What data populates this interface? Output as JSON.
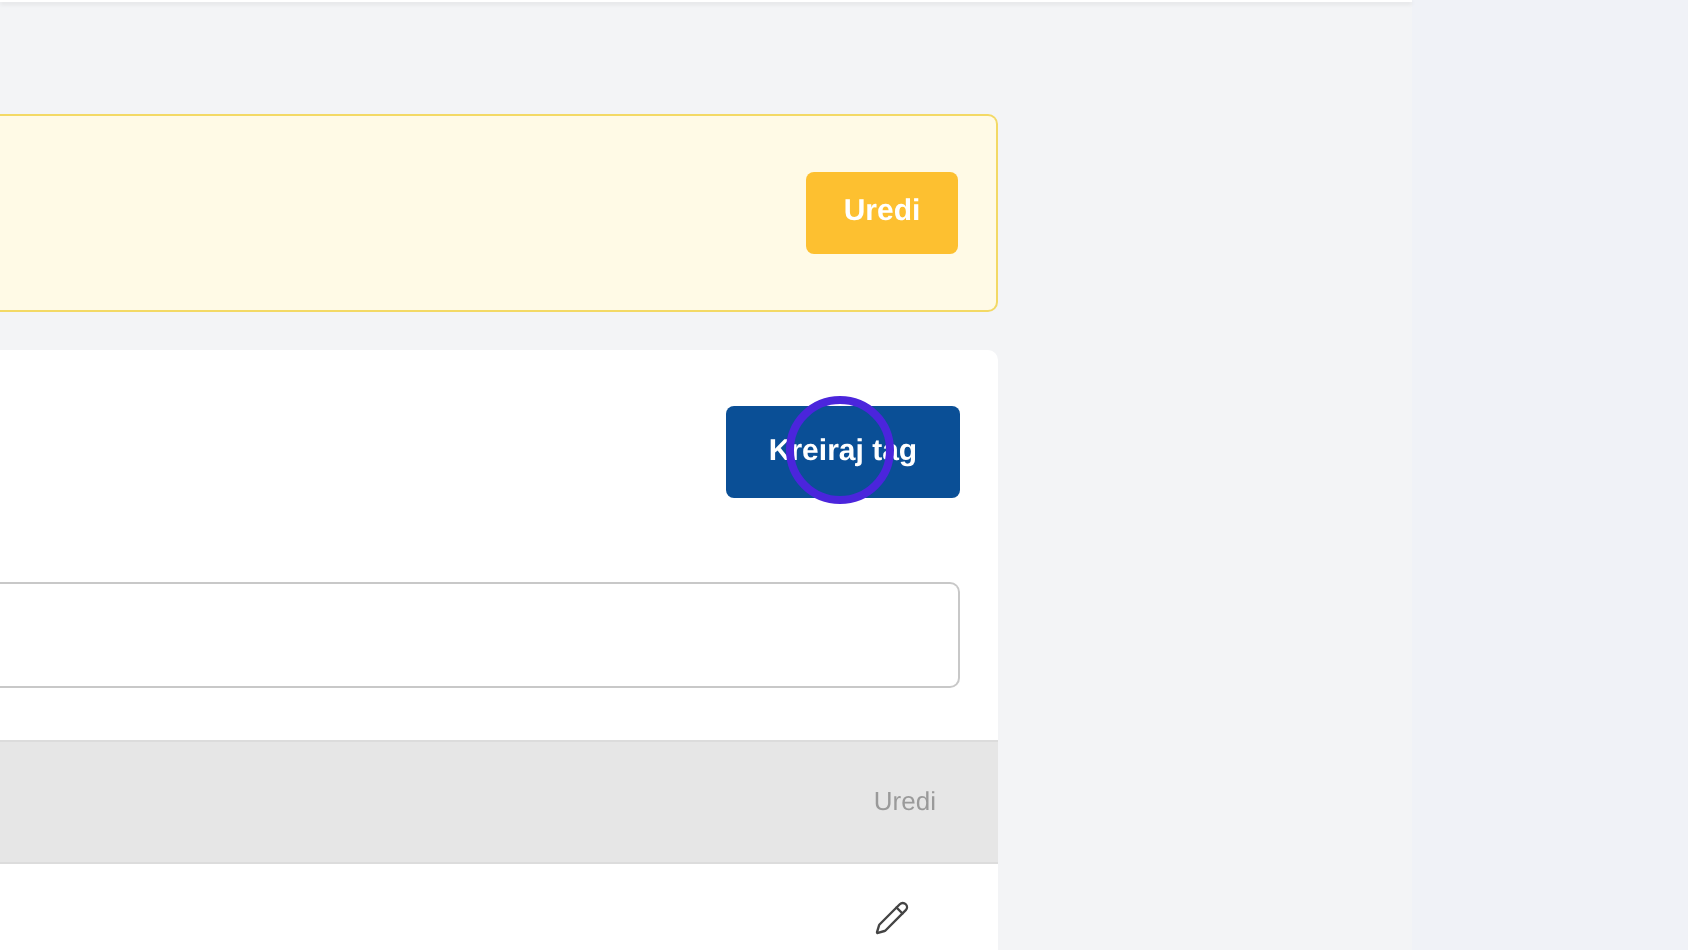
{
  "edit_banner": {
    "button": "Uredi"
  },
  "tags": {
    "create_button": "Kreiraj tag",
    "table": {
      "columns": [
        "Uredi"
      ]
    }
  }
}
